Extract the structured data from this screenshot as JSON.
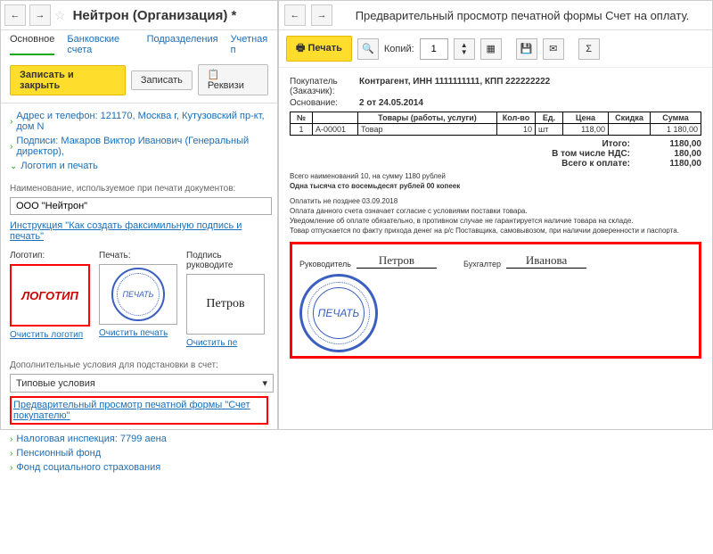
{
  "left": {
    "title": "Нейтрон (Организация) *",
    "tabs": {
      "main": "Основное",
      "bank": "Банковские счета",
      "dept": "Подразделения",
      "acct": "Учетная п"
    },
    "buttons": {
      "save_close": "Записать и закрыть",
      "save": "Записать",
      "req": "Реквизи"
    },
    "tree": {
      "address": "Адрес и телефон: 121170, Москва г, Кутузовский пр-кт, дом N",
      "signs": "Подписи: Макаров Виктор Иванович (Генеральный директор),",
      "logo": "Логотип и печать"
    },
    "name_hint": "Наименование, используемое при печати документов:",
    "name_value": "ООО \"Нейтрон\"",
    "instr_link": "Инструкция \"Как создать факсимильную подпись и печать\"",
    "thumbs": {
      "logo_lbl": "Логотип:",
      "stamp_lbl": "Печать:",
      "sign_lbl": "Подпись руководите",
      "logo_text": "ЛОГОТИП",
      "stamp_text": "ПЕЧАТЬ",
      "sign_text": "Петров"
    },
    "clear": {
      "logo": "Очистить логотип",
      "stamp": "Очистить печать",
      "sign": "Очистить пе"
    },
    "cond_hint": "Дополнительные условия для подстановки в счет:",
    "cond_value": "Типовые условия",
    "preview_link": "Предварительный просмотр печатной формы \"Счет покупателю\"",
    "tree2": {
      "tax": "Налоговая инспекция: 7799 аена",
      "pens": "Пенсионный фонд",
      "soc": "Фонд социального страхования"
    }
  },
  "right": {
    "title": "Предварительный просмотр печатной формы Счет на оплату.",
    "print_btn": "Печать",
    "copies_lbl": "Копий:",
    "copies_val": "1",
    "doc": {
      "buyer_lbl": "Покупатель (Заказчик):",
      "buyer": "Контрагент, ИНН 1111111111, КПП 222222222",
      "basis_lbl": "Основание:",
      "basis": "2 от 24.05.2014"
    },
    "tbl": {
      "h": {
        "n": "№",
        "code": "",
        "name": "Товары (работы, услуги)",
        "qty": "Кол-во",
        "unit": "Ед.",
        "price": "Цена",
        "disc": "Скидка",
        "sum": "Сумма"
      },
      "r": {
        "n": "1",
        "code": "А-00001",
        "name": "Товар",
        "qty": "10",
        "unit": "шт",
        "price": "118,00",
        "disc": "",
        "sum": "1 180,00"
      }
    },
    "totals": {
      "itogo_l": "Итого:",
      "itogo": "1180,00",
      "nds_l": "В том числе НДС:",
      "nds": "180,00",
      "pay_l": "Всего к оплате:",
      "pay": "1180,00"
    },
    "summary1": "Всего наименований 10, на сумму 1180 рублей",
    "summary2": "Одна тысяча сто восемьдесят рублей 00 копеек",
    "fine1": "Оплатить не позднее 03.09.2018",
    "fine2": "Оплата данного счета означает согласие с условиями поставки товара.",
    "fine3": "Уведомление об оплате обязательно, в противном случае не гарантируется наличие товара на складе.",
    "fine4": "Товар отпускается по факту прихода денег на р/с Поставщика, самовывозом, при наличии доверенности и паспорта.",
    "sig": {
      "head_lbl": "Руководитель",
      "head": "Петров",
      "acc_lbl": "Бухгалтер",
      "acc": "Иванова",
      "stamp": "ПЕЧАТЬ"
    }
  }
}
